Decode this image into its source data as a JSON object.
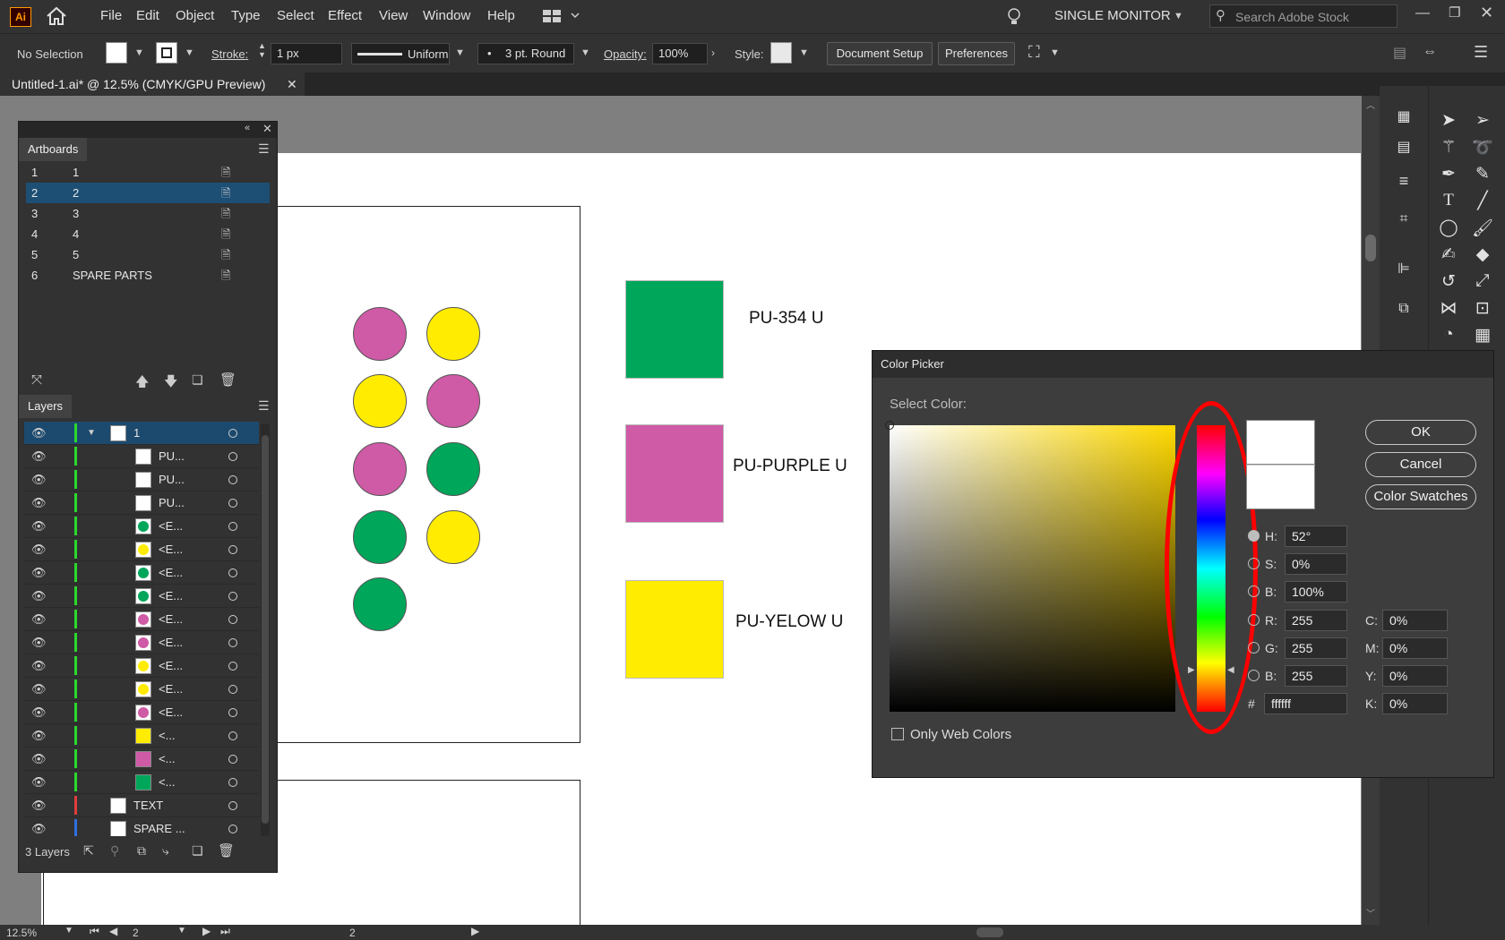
{
  "app": {
    "logo": "Ai",
    "workspace": "SINGLE MONITOR",
    "search_placeholder": "Search Adobe Stock"
  },
  "menu": [
    "File",
    "Edit",
    "Object",
    "Type",
    "Select",
    "Effect",
    "View",
    "Window",
    "Help"
  ],
  "control": {
    "selection": "No Selection",
    "stroke_label": "Stroke:",
    "stroke_value": "1 px",
    "profile": "Uniform",
    "brush": "3 pt. Round",
    "opacity_label": "Opacity:",
    "opacity_value": "100%",
    "style_label": "Style:",
    "doc_setup": "Document Setup",
    "preferences": "Preferences"
  },
  "doc_tab": "Untitled-1.ai* @ 12.5% (CMYK/GPU Preview)",
  "colors": {
    "green": "#00a65a",
    "purple": "#cf5aa6",
    "yellow": "#ffec00"
  },
  "swatches": [
    {
      "label": "PU-354 U",
      "color": "green"
    },
    {
      "label": "PU-PURPLE U",
      "color": "purple"
    },
    {
      "label": "PU-YELOW U",
      "color": "yellow"
    }
  ],
  "artboards_panel": {
    "title": "Artboards",
    "rows": [
      {
        "num": "1",
        "name": "1"
      },
      {
        "num": "2",
        "name": "2"
      },
      {
        "num": "3",
        "name": "3"
      },
      {
        "num": "4",
        "name": "4"
      },
      {
        "num": "5",
        "name": "5"
      },
      {
        "num": "6",
        "name": "SPARE PARTS"
      }
    ]
  },
  "layers_panel": {
    "title": "Layers",
    "count": "3 Layers",
    "rows": [
      {
        "name": "1",
        "bar": "#2bd92b"
      },
      {
        "name": "PU...",
        "bar": "#2bd92b"
      },
      {
        "name": "PU...",
        "bar": "#2bd92b"
      },
      {
        "name": "PU...",
        "bar": "#2bd92b"
      },
      {
        "name": "<E...",
        "bar": "#2bd92b"
      },
      {
        "name": "<E...",
        "bar": "#2bd92b"
      },
      {
        "name": "<E...",
        "bar": "#2bd92b"
      },
      {
        "name": "<E...",
        "bar": "#2bd92b"
      },
      {
        "name": "<E...",
        "bar": "#2bd92b"
      },
      {
        "name": "<E...",
        "bar": "#2bd92b"
      },
      {
        "name": "<E...",
        "bar": "#2bd92b"
      },
      {
        "name": "<E...",
        "bar": "#2bd92b"
      },
      {
        "name": "<E...",
        "bar": "#2bd92b"
      },
      {
        "name": "<...",
        "bar": "#2bd92b"
      },
      {
        "name": "<...",
        "bar": "#2bd92b"
      },
      {
        "name": "<...",
        "bar": "#2bd92b"
      },
      {
        "name": "TEXT",
        "bar": "#e23c3c"
      },
      {
        "name": "SPARE ...",
        "bar": "#2f6fe0"
      }
    ]
  },
  "color_picker": {
    "title": "Color Picker",
    "select_label": "Select Color:",
    "ok": "OK",
    "cancel": "Cancel",
    "swatches_btn": "Color Swatches",
    "h_label": "H:",
    "h": "52°",
    "s_label": "S:",
    "s": "0%",
    "b_label": "B:",
    "b": "100%",
    "r_label": "R:",
    "r": "255",
    "g_label": "G:",
    "g": "255",
    "bl_label": "B:",
    "bl": "255",
    "hash": "#",
    "hex": "ffffff",
    "c_label": "C:",
    "c": "0%",
    "m_label": "M:",
    "m": "0%",
    "y_label": "Y:",
    "y": "0%",
    "k_label": "K:",
    "k": "0%",
    "web_only": "Only Web Colors"
  },
  "status": {
    "zoom": "12.5%",
    "artboard": "2",
    "center": "2"
  }
}
